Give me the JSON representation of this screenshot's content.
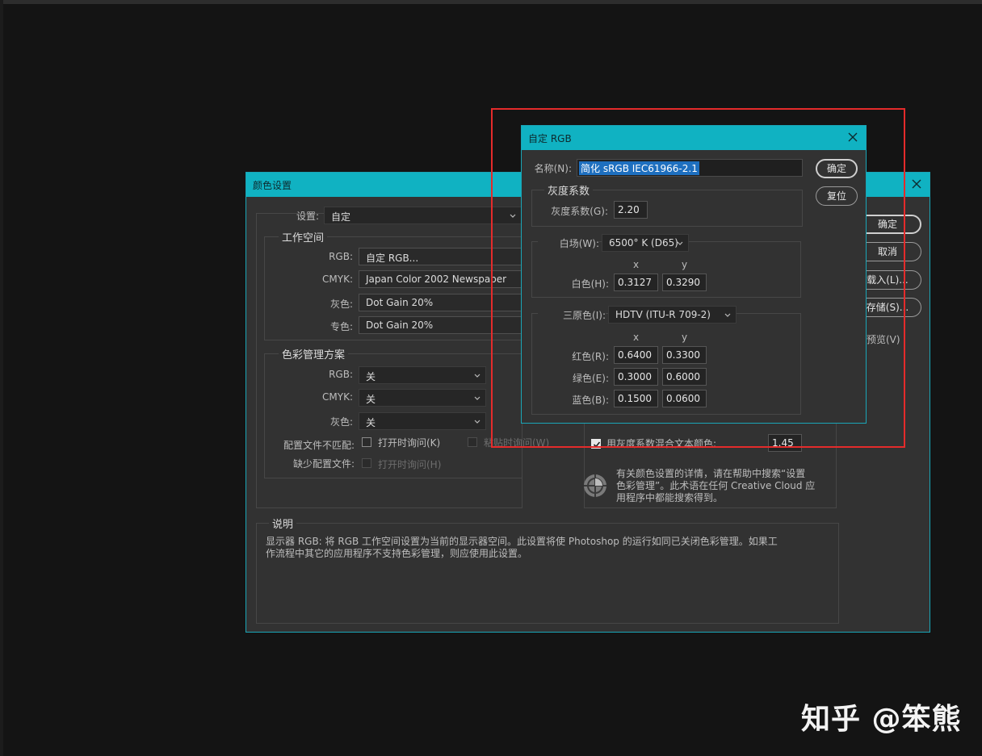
{
  "color_settings": {
    "title": "颜色设置",
    "settings_label": "设置:",
    "settings_value": "自定",
    "working_spaces": {
      "title": "工作空间",
      "rgb_label": "RGB:",
      "rgb_value": "自定 RGB...",
      "cmyk_label": "CMYK:",
      "cmyk_value": "Japan Color 2002 Newspaper",
      "gray_label": "灰色:",
      "gray_value": "Dot Gain 20%",
      "spot_label": "专色:",
      "spot_value": "Dot Gain 20%"
    },
    "policies": {
      "title": "色彩管理方案",
      "rgb_label": "RGB:",
      "rgb_value": "关",
      "cmyk_label": "CMYK:",
      "cmyk_value": "关",
      "gray_label": "灰色:",
      "gray_value": "关",
      "mismatch_label": "配置文件不匹配:",
      "mismatch_open": "打开时询问(K)",
      "mismatch_paste": "粘贴时询问(W)",
      "missing_label": "缺少配置文件:",
      "missing_open": "打开时询问(H)"
    },
    "buttons": {
      "ok": "确定",
      "cancel": "取消",
      "load": "载入(L)...",
      "save": "存储(S)...",
      "preview": "预览(V)"
    },
    "blend_label": "用灰度系数混合文本颜色:",
    "blend_value": "1.45",
    "help_text_1": "有关颜色设置的详情，请在帮助中搜索“设置",
    "help_text_2": "色彩管理”。此术语在任何 Creative Cloud 应",
    "help_text_3": "用程序中都能搜索得到。",
    "description": {
      "title": "说明",
      "line1": "显示器 RGB: 将 RGB 工作空间设置为当前的显示器空间。此设置将使 Photoshop 的运行如同已关闭色彩管理。如果工",
      "line2": "作流程中其它的应用程序不支持色彩管理，则应使用此设置。"
    }
  },
  "custom_rgb": {
    "title": "自定 RGB",
    "name_label": "名称(N):",
    "name_value": "简化 sRGB IEC61966-2.1",
    "ok": "确定",
    "reset": "复位",
    "gamma_group": "灰度系数",
    "gamma_label": "灰度系数(G):",
    "gamma_value": "2.20",
    "white_point_label": "白场(W):",
    "white_point_value": "6500° K (D65)",
    "x_header": "x",
    "y_header": "y",
    "white_label": "白色(H):",
    "white_x": "0.3127",
    "white_y": "0.3290",
    "primaries_label": "三原色(I):",
    "primaries_value": "HDTV (ITU-R 709-2)",
    "red_label": "红色(R):",
    "red_x": "0.6400",
    "red_y": "0.3300",
    "green_label": "绿色(E):",
    "green_x": "0.3000",
    "green_y": "0.6000",
    "blue_label": "蓝色(B):",
    "blue_x": "0.1500",
    "blue_y": "0.0600"
  },
  "watermark": "知乎 @笨熊",
  "colors": {
    "accent": "#10b2c2",
    "highlight_box": "#e42b2b",
    "background": "#141414",
    "dialog_bg": "#323232"
  }
}
